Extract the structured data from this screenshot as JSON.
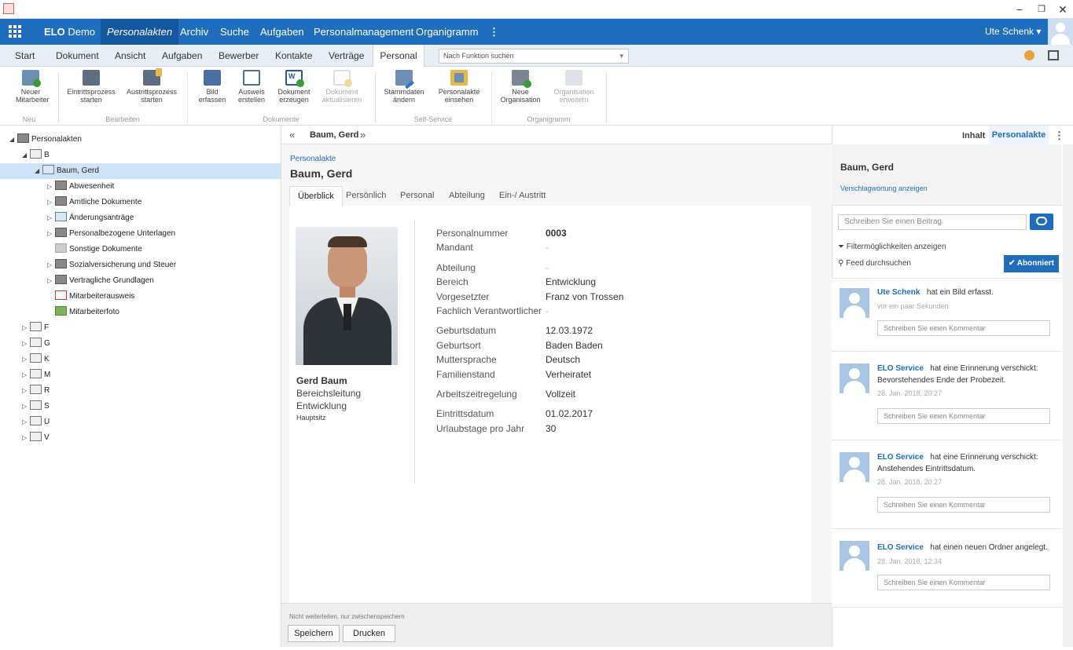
{
  "window": {
    "minimize": "−",
    "restore": "❐",
    "close": "✕"
  },
  "nav": {
    "app_name": "ELO",
    "app_suffix": "Demo",
    "items": [
      "Personalakten",
      "Archiv",
      "Suche",
      "Aufgaben",
      "Personalmanagement",
      "Organigramm"
    ],
    "more": "⋮",
    "user": "Ute Schenk ▾"
  },
  "ribbon_tabs": [
    "Start",
    "Dokument",
    "Ansicht",
    "Aufgaben",
    "Bewerber",
    "Kontakte",
    "Verträge",
    "Personal"
  ],
  "function_search": {
    "placeholder": "Nach Funktion suchen",
    "chevron": "▾"
  },
  "ribbon": {
    "buttons": [
      {
        "l1": "Neuer",
        "l2": "Mitarbeiter",
        "icon": "new-employee-icon"
      },
      {
        "l1": "Eintrittsprozess",
        "l2": "starten",
        "icon": "entry-process-icon"
      },
      {
        "l1": "Austrittsprozess",
        "l2": "starten",
        "icon": "exit-process-icon"
      },
      {
        "l1": "Bild",
        "l2": "erfassen",
        "icon": "capture-image-icon"
      },
      {
        "l1": "Ausweis",
        "l2": "erstellen",
        "icon": "id-card-icon"
      },
      {
        "l1": "Dokument",
        "l2": "erzeugen",
        "icon": "word-document-icon"
      },
      {
        "l1": "Dokument",
        "l2": "aktualisieren",
        "icon": "update-document-icon"
      },
      {
        "l1": "Stammdaten",
        "l2": "ändern",
        "icon": "edit-master-data-icon"
      },
      {
        "l1": "Personalakte",
        "l2": "einsehen",
        "icon": "view-file-icon"
      },
      {
        "l1": "Neue",
        "l2": "Organisation",
        "icon": "new-organisation-icon"
      },
      {
        "l1": "Organisation",
        "l2": "erweitern",
        "icon": "extend-organisation-icon"
      }
    ],
    "groups": [
      "Neu",
      "Bearbeiten",
      "Dokumente",
      "Self-Service",
      "Organigramm"
    ]
  },
  "tree": {
    "root": "Personalakten",
    "b": "B",
    "person": "Baum, Gerd",
    "children": [
      "Abwesenheit",
      "Amtliche Dokumente",
      "Änderungsanträge",
      "Personalbezogene Unterlagen",
      "Sonstige Dokumente",
      "Sozialversicherung und Steuer",
      "Vertragliche Grundlagen",
      "Mitarbeiterausweis",
      "Mitarbeiterfoto"
    ],
    "letters": [
      "F",
      "G",
      "K",
      "M",
      "R",
      "S",
      "U",
      "V"
    ]
  },
  "center": {
    "back": "«",
    "title": "Baum, Gerd",
    "fwd": "»",
    "kind": "Personalakte",
    "name": "Baum, Gerd",
    "tabs": [
      "Überblick",
      "Persönlich",
      "Personal",
      "Abteilung",
      "Ein-/ Austritt"
    ],
    "person": {
      "name": "Gerd Baum",
      "role": "Bereichsleitung",
      "dept": "Entwicklung",
      "site": "Hauptsitz"
    },
    "fields": [
      {
        "label": "Personalnummer",
        "value": "0003"
      },
      {
        "label": "Mandant",
        "value": "-"
      },
      {
        "label": "Abteilung",
        "value": "-"
      },
      {
        "label": "Bereich",
        "value": "Entwicklung"
      },
      {
        "label": "Vorgesetzter",
        "value": "Franz von Trossen"
      },
      {
        "label": "Fachlich Verantwortlicher",
        "value": "-"
      },
      {
        "label": "Geburtsdatum",
        "value": "12.03.1972"
      },
      {
        "label": "Geburtsort",
        "value": "Baden Baden"
      },
      {
        "label": "Muttersprache",
        "value": "Deutsch"
      },
      {
        "label": "Familienstand",
        "value": "Verheiratet"
      },
      {
        "label": "Arbeitszeitregelung",
        "value": "Vollzeit"
      },
      {
        "label": "Eintrittsdatum",
        "value": "01.02.2017"
      },
      {
        "label": "Urlaubstage pro Jahr",
        "value": "30"
      }
    ],
    "footer_note": "Nicht weiterleiten, nur zwischenspeichern",
    "save": "Speichern",
    "print": "Drucken"
  },
  "right": {
    "tab_content": "Inhalt",
    "tab_file": "Personalakte",
    "more": "⋮",
    "title": "Baum, Gerd",
    "keywords": "Verschlagwortung anzeigen",
    "post_placeholder": "Schreiben Sie einen Beitrag",
    "filter": "Filtermöglichkeiten anzeigen",
    "search": "Feed durchsuchen",
    "subscribe": "Abonniert",
    "comment_placeholder": "Schreiben Sie einen Kommentar",
    "feed": [
      {
        "user": "Ute Schenk",
        "text": "hat ein Bild erfasst.",
        "extra": "",
        "time": "vor ein paar Sekunden"
      },
      {
        "user": "ELO Service",
        "text": "hat eine Erinnerung verschickt:",
        "extra": "Bevorstehendes Ende der Probezeit.",
        "time": "28. Jan. 2018, 20:27"
      },
      {
        "user": "ELO Service",
        "text": "hat eine Erinnerung verschickt:",
        "extra": "Anstehendes Eintrittsdatum.",
        "time": "28. Jan. 2018, 20:27"
      },
      {
        "user": "ELO Service",
        "text": "hat einen neuen Ordner angelegt.",
        "extra": "",
        "time": "28. Jan. 2018, 12:34"
      }
    ]
  },
  "colors": {
    "primary": "#1f6dbd",
    "nav_active": "#14579e",
    "selection": "#cfe3f7"
  }
}
